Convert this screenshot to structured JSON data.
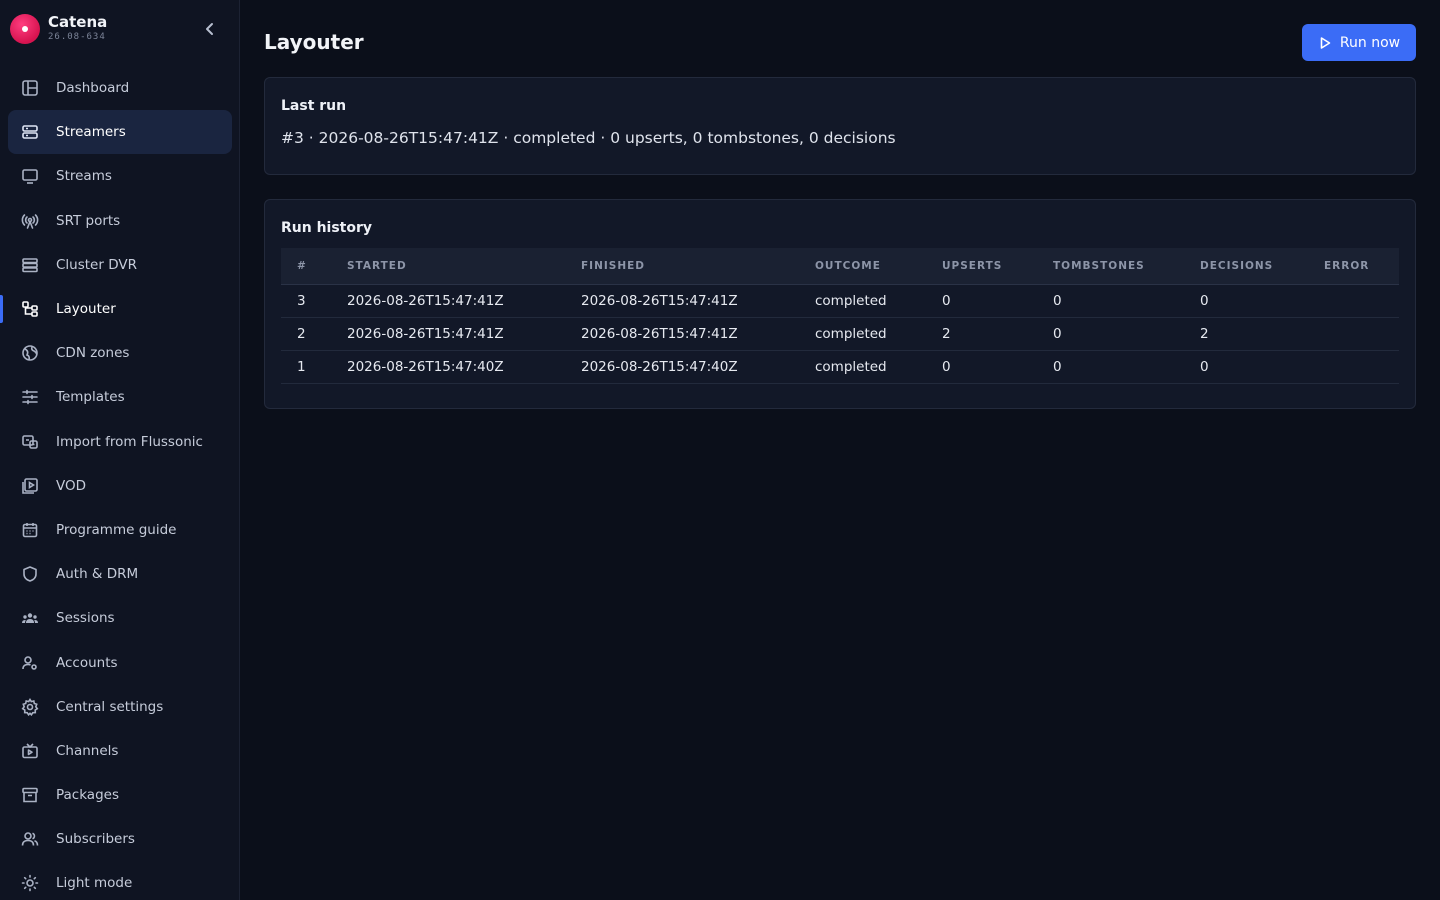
{
  "brand": {
    "name": "Catena",
    "version": "26.08-634"
  },
  "sidebar": {
    "items": [
      {
        "label": "Dashboard",
        "icon": "dashboard-icon"
      },
      {
        "label": "Streamers",
        "icon": "server-icon"
      },
      {
        "label": "Streams",
        "icon": "monitor-icon"
      },
      {
        "label": "SRT ports",
        "icon": "antenna-icon"
      },
      {
        "label": "Cluster DVR",
        "icon": "storage-icon"
      },
      {
        "label": "Layouter",
        "icon": "layout-tree-icon"
      },
      {
        "label": "CDN zones",
        "icon": "globe-icon"
      },
      {
        "label": "Templates",
        "icon": "sliders-icon"
      },
      {
        "label": "Import from Flussonic",
        "icon": "import-icon"
      },
      {
        "label": "VOD",
        "icon": "video-library-icon"
      },
      {
        "label": "Programme guide",
        "icon": "calendar-icon"
      },
      {
        "label": "Auth & DRM",
        "icon": "shield-icon"
      },
      {
        "label": "Sessions",
        "icon": "users-group-icon"
      },
      {
        "label": "Accounts",
        "icon": "user-gear-icon"
      },
      {
        "label": "Central settings",
        "icon": "gear-icon"
      },
      {
        "label": "Channels",
        "icon": "tv-icon"
      },
      {
        "label": "Packages",
        "icon": "archive-icon"
      },
      {
        "label": "Subscribers",
        "icon": "users-icon"
      },
      {
        "label": "Light mode",
        "icon": "sun-icon"
      }
    ],
    "highlighted": "Streamers",
    "current": "Layouter"
  },
  "header": {
    "title": "Layouter",
    "run_label": "Run now"
  },
  "last_run": {
    "title": "Last run",
    "summary": "#3 · 2026-08-26T15:47:41Z · completed · 0 upserts, 0 tombstones, 0 decisions"
  },
  "history": {
    "title": "Run history",
    "columns": [
      "#",
      "STARTED",
      "FINISHED",
      "OUTCOME",
      "UPSERTS",
      "TOMBSTONES",
      "DECISIONS",
      "ERROR"
    ],
    "rows": [
      [
        "3",
        "2026-08-26T15:47:41Z",
        "2026-08-26T15:47:41Z",
        "completed",
        "0",
        "0",
        "0",
        ""
      ],
      [
        "2",
        "2026-08-26T15:47:41Z",
        "2026-08-26T15:47:41Z",
        "completed",
        "2",
        "0",
        "2",
        ""
      ],
      [
        "1",
        "2026-08-26T15:47:40Z",
        "2026-08-26T15:47:40Z",
        "completed",
        "0",
        "0",
        "0",
        ""
      ]
    ]
  },
  "colors": {
    "accent": "#3b6cf6",
    "brand": "#e11d5a",
    "background": "#0b0f1a"
  }
}
